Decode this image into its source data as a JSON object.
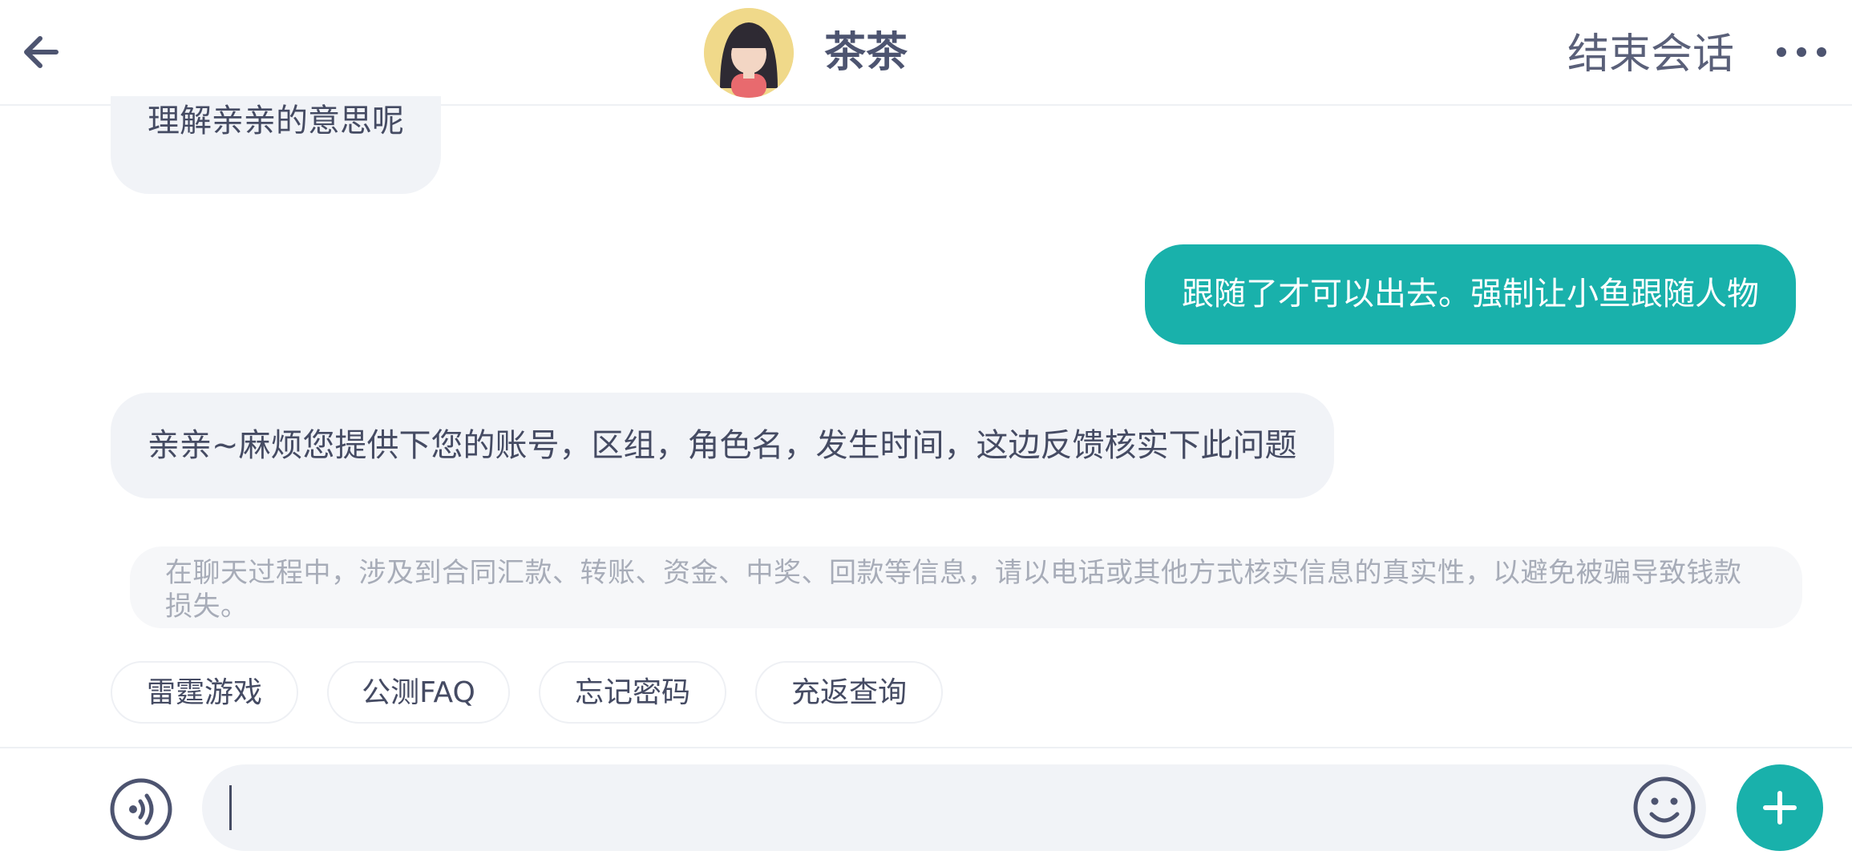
{
  "header": {
    "back_icon": "arrow-left-icon",
    "contact_name": "茶茶",
    "end_session_label": "结束会话",
    "more_icon": "more-horizontal-icon"
  },
  "messages": [
    {
      "side": "incoming",
      "text": "理解亲亲的意思呢"
    },
    {
      "side": "outgoing",
      "text": "跟随了才可以出去。强制让小鱼跟随人物"
    },
    {
      "side": "incoming",
      "text": "亲亲~麻烦您提供下您的账号，区组，角色名，发生时间，这边反馈核实下此问题"
    }
  ],
  "notice": {
    "text": "在聊天过程中，涉及到合同汇款、转账、资金、中奖、回款等信息，请以电话或其他方式核实信息的真实性，以避免被骗导致钱款损失。"
  },
  "quick_replies": [
    "雷霆游戏",
    "公测FAQ",
    "忘记密码",
    "充返查询"
  ],
  "input": {
    "value": "",
    "voice_icon": "voice-icon",
    "emoji_icon": "emoji-icon",
    "plus_icon": "plus-icon"
  },
  "colors": {
    "accent": "#19b1ab",
    "incoming_bubble": "#f1f3f7",
    "text": "#454b63",
    "notice_text": "#a7acb8"
  }
}
